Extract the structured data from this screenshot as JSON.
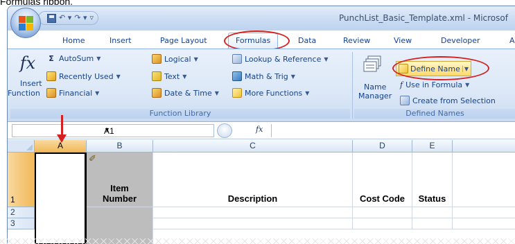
{
  "caption": "Formulas ribbon.",
  "window": {
    "title": "PunchList_Basic_Template.xml - Microsof",
    "qat": {
      "undo": "↶ ▾",
      "redo": "↷ ▾",
      "more": "▿"
    }
  },
  "tabs": [
    "Home",
    "Insert",
    "Page Layout",
    "Formulas",
    "Data",
    "Review",
    "View",
    "Developer",
    "A"
  ],
  "active_tab": "Formulas",
  "ribbon": {
    "function_library": {
      "label": "Function Library",
      "insert_function": {
        "icon": "fx",
        "line1": "Insert",
        "line2": "Function"
      },
      "autosum": "AutoSum",
      "recently_used": "Recently Used",
      "financial": "Financial",
      "logical": "Logical",
      "text": "Text",
      "date_time": "Date & Time",
      "lookup": "Lookup & Reference",
      "math": "Math & Trig",
      "more": "More Functions"
    },
    "defined_names": {
      "label": "Defined Names",
      "name_manager": {
        "line1": "Name",
        "line2": "Manager"
      },
      "define_name": "Define Name",
      "use_in_formula": "Use in Formula",
      "create_from_selection": "Create from Selection"
    }
  },
  "formula_bar": {
    "name_box": "A1",
    "fx": "fx"
  },
  "sheet": {
    "columns": [
      "A",
      "B",
      "C",
      "D",
      "E"
    ],
    "rows": [
      "1",
      "2",
      "3"
    ],
    "headers": {
      "B1_line1": "Item",
      "B1_line2": "Number",
      "C1": "Description",
      "D1": "Cost Code",
      "E1": "Status"
    }
  },
  "colors": {
    "highlight_circle": "#d42020",
    "ribbon_text": "#15428b",
    "selected_header": "#f1b95a"
  }
}
